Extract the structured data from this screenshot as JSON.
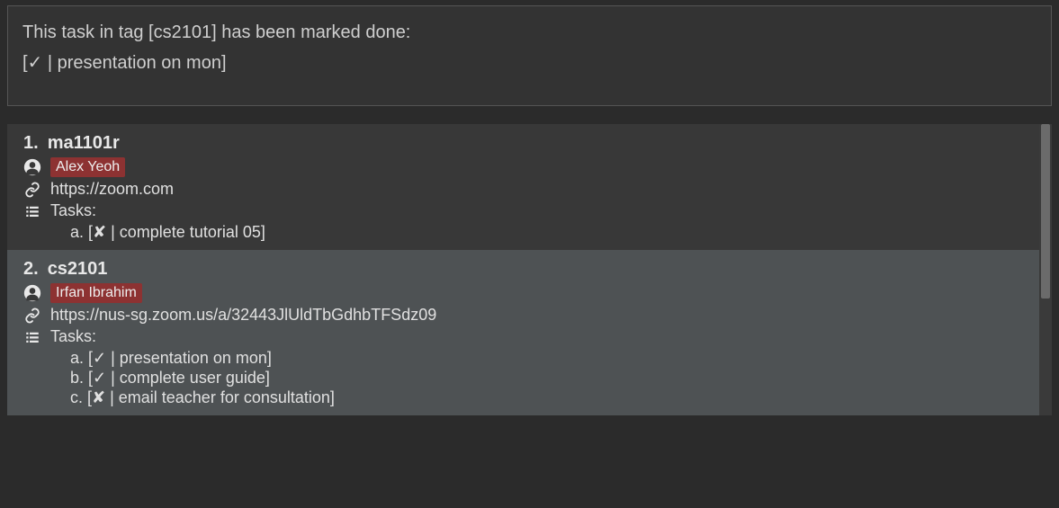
{
  "status": {
    "line1": "This task in tag [cs2101] has been marked done:",
    "line2": "[✓ | presentation on mon]"
  },
  "modules": [
    {
      "index": "1.",
      "name": "ma1101r",
      "person": "Alex Yeoh",
      "link": "https://zoom.com",
      "tasks_label": "Tasks:",
      "tasks": [
        {
          "letter": "a.",
          "done": false,
          "text": "complete tutorial 05"
        }
      ],
      "shade": "dark"
    },
    {
      "index": "2.",
      "name": "cs2101",
      "person": "Irfan Ibrahim",
      "link": "https://nus-sg.zoom.us/a/32443JlUldTbGdhbTFSdz09",
      "tasks_label": "Tasks:",
      "tasks": [
        {
          "letter": "a.",
          "done": true,
          "text": "presentation on mon"
        },
        {
          "letter": "b.",
          "done": true,
          "text": "complete user guide"
        },
        {
          "letter": "c.",
          "done": false,
          "text": "email teacher for consultation"
        }
      ],
      "shade": "light"
    }
  ],
  "icons": {
    "check": "✓",
    "cross": "✘"
  }
}
